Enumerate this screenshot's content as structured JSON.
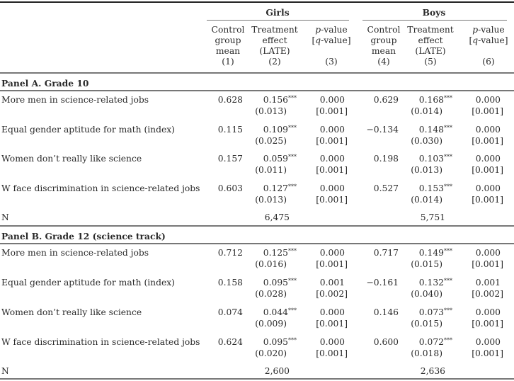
{
  "header": {
    "groups": [
      "Girls",
      "Boys"
    ],
    "columns": [
      {
        "lines": [
          "Control",
          "group",
          "mean",
          "(1)"
        ]
      },
      {
        "lines": [
          "Treatment",
          "effect",
          "(LATE)",
          "(2)"
        ]
      },
      {
        "lines": [
          "p-value",
          "[q-value]",
          "",
          "(3)"
        ]
      },
      {
        "lines": [
          "Control",
          "group",
          "mean",
          "(4)"
        ]
      },
      {
        "lines": [
          "Treatment",
          "effect",
          "(LATE)",
          "(5)"
        ]
      },
      {
        "lines": [
          "p-value",
          "[q-value]",
          "",
          "(6)"
        ]
      }
    ]
  },
  "panels": [
    {
      "title": "Panel A. Grade 10",
      "rows": [
        {
          "label": "More men in science-related jobs",
          "girls": {
            "mean": "0.628",
            "effect": "0.156",
            "stars": "***",
            "se": "(0.013)",
            "p": "0.000",
            "q": "[0.001]"
          },
          "boys": {
            "mean": "0.629",
            "effect": "0.168",
            "stars": "***",
            "se": "(0.014)",
            "p": "0.000",
            "q": "[0.001]"
          }
        },
        {
          "label": "Equal gender aptitude for math (index)",
          "girls": {
            "mean": "0.115",
            "effect": "0.109",
            "stars": "***",
            "se": "(0.025)",
            "p": "0.000",
            "q": "[0.001]"
          },
          "boys": {
            "mean": "−0.134",
            "effect": "0.148",
            "stars": "***",
            "se": "(0.030)",
            "p": "0.000",
            "q": "[0.001]"
          }
        },
        {
          "label": "Women don’t really like science",
          "girls": {
            "mean": "0.157",
            "effect": "0.059",
            "stars": "***",
            "se": "(0.011)",
            "p": "0.000",
            "q": "[0.001]"
          },
          "boys": {
            "mean": "0.198",
            "effect": "0.103",
            "stars": "***",
            "se": "(0.013)",
            "p": "0.000",
            "q": "[0.001]"
          }
        },
        {
          "label": "W face discrimination in science-related jobs",
          "girls": {
            "mean": "0.603",
            "effect": "0.127",
            "stars": "***",
            "se": "(0.013)",
            "p": "0.000",
            "q": "[0.001]"
          },
          "boys": {
            "mean": "0.527",
            "effect": "0.153",
            "stars": "***",
            "se": "(0.014)",
            "p": "0.000",
            "q": "[0.001]"
          }
        }
      ],
      "n": {
        "label": "N",
        "girls": "6,475",
        "boys": "5,751"
      }
    },
    {
      "title": "Panel B. Grade 12 (science track)",
      "rows": [
        {
          "label": "More men in science-related jobs",
          "girls": {
            "mean": "0.712",
            "effect": "0.125",
            "stars": "***",
            "se": "(0.016)",
            "p": "0.000",
            "q": "[0.001]"
          },
          "boys": {
            "mean": "0.717",
            "effect": "0.149",
            "stars": "***",
            "se": "(0.015)",
            "p": "0.000",
            "q": "[0.001]"
          }
        },
        {
          "label": "Equal gender aptitude for math (index)",
          "girls": {
            "mean": "0.158",
            "effect": "0.095",
            "stars": "***",
            "se": "(0.028)",
            "p": "0.001",
            "q": "[0.002]"
          },
          "boys": {
            "mean": "−0.161",
            "effect": "0.132",
            "stars": "***",
            "se": "(0.040)",
            "p": "0.001",
            "q": "[0.002]"
          }
        },
        {
          "label": "Women don’t really like science",
          "girls": {
            "mean": "0.074",
            "effect": "0.044",
            "stars": "***",
            "se": "(0.009)",
            "p": "0.000",
            "q": "[0.001]"
          },
          "boys": {
            "mean": "0.146",
            "effect": "0.073",
            "stars": "***",
            "se": "(0.015)",
            "p": "0.000",
            "q": "[0.001]"
          }
        },
        {
          "label": "W face discrimination in science-related jobs",
          "girls": {
            "mean": "0.624",
            "effect": "0.095",
            "stars": "***",
            "se": "(0.020)",
            "p": "0.000",
            "q": "[0.001]"
          },
          "boys": {
            "mean": "0.600",
            "effect": "0.072",
            "stars": "***",
            "se": "(0.018)",
            "p": "0.000",
            "q": "[0.001]"
          }
        }
      ],
      "n": {
        "label": "N",
        "girls": "2,600",
        "boys": "2,636"
      }
    }
  ]
}
